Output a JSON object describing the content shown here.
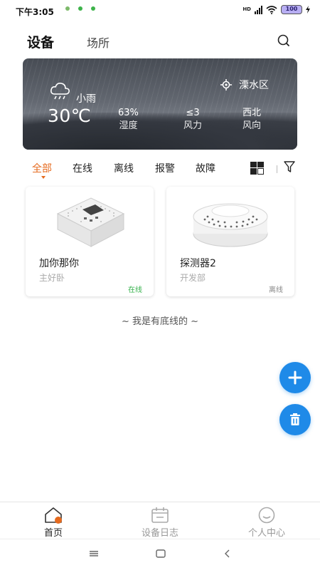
{
  "status_bar": {
    "time": "下午3:05",
    "notif_dot_colors": [
      "#7dba6a",
      "#3db34a",
      "#3db34a"
    ],
    "network": "HD",
    "battery": "100"
  },
  "header": {
    "title": "设备",
    "second_tab": "场所",
    "search_icon": "search-icon"
  },
  "weather": {
    "condition": "小雨",
    "temperature": "30℃",
    "location": "溧水区",
    "humidity_value": "63%",
    "humidity_label": "湿度",
    "wind_level": "≤3",
    "wind_label": "风力",
    "wind_dir": "西北",
    "wind_dir_label": "风向"
  },
  "filters": {
    "items": [
      "全部",
      "在线",
      "离线",
      "报警",
      "故障"
    ],
    "active": "全部",
    "accent_color": "#e56a1e"
  },
  "devices": [
    {
      "name": "加你那你",
      "place": "主好卧",
      "status": "在线",
      "status_type": "online"
    },
    {
      "name": "探测器2",
      "place": "开发部",
      "status": "离线",
      "status_type": "offline"
    }
  ],
  "end_text": "~  我是有底线的  ~",
  "fabs": {
    "add_icon": "plus-icon",
    "delete_icon": "trash-icon",
    "color": "#1f8ae8"
  },
  "bottom_nav": {
    "items": [
      {
        "label": "首页",
        "icon": "home-icon",
        "active": true
      },
      {
        "label": "设备日志",
        "icon": "calendar-icon",
        "active": false
      },
      {
        "label": "个人中心",
        "icon": "smile-icon",
        "active": false
      }
    ]
  },
  "system_nav": {
    "icons": [
      "menu-icon",
      "home-square-icon",
      "back-icon"
    ]
  }
}
